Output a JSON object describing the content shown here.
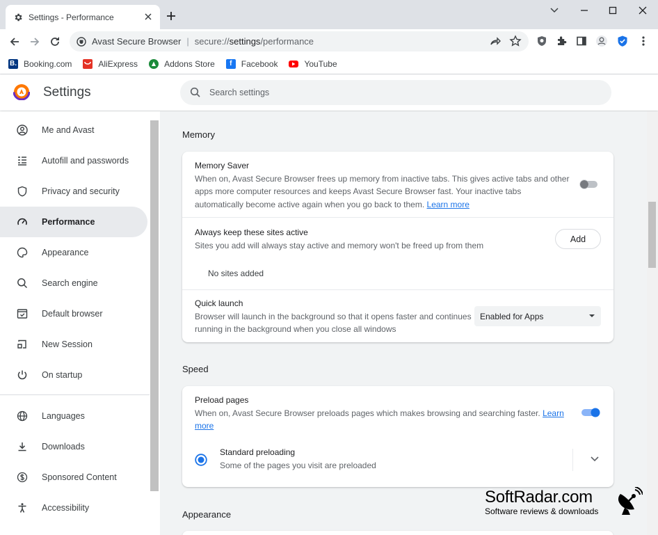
{
  "browser": {
    "tab_title": "Settings - Performance",
    "omnibox_site": "Avast Secure Browser",
    "omnibox_url_prefix": "secure://",
    "omnibox_url_main": "settings",
    "omnibox_url_suffix": "/performance",
    "bookmarks": [
      {
        "label": "Booking.com",
        "icon": "booking-icon",
        "color": "#003580"
      },
      {
        "label": "AliExpress",
        "icon": "aliexpress-icon",
        "color": "#e43225"
      },
      {
        "label": "Addons Store",
        "icon": "addons-store-icon",
        "color": "#1b8a3a"
      },
      {
        "label": "Facebook",
        "icon": "facebook-icon",
        "color": "#1877f2"
      },
      {
        "label": "YouTube",
        "icon": "youtube-icon",
        "color": "#ff0000"
      }
    ]
  },
  "settings": {
    "title": "Settings",
    "search_placeholder": "Search settings",
    "sidebar": [
      {
        "label": "Me and Avast",
        "icon": "person-icon"
      },
      {
        "label": "Autofill and passwords",
        "icon": "autofill-icon"
      },
      {
        "label": "Privacy and security",
        "icon": "shield-icon"
      },
      {
        "label": "Performance",
        "icon": "speedometer-icon",
        "active": true
      },
      {
        "label": "Appearance",
        "icon": "palette-icon"
      },
      {
        "label": "Search engine",
        "icon": "search-icon"
      },
      {
        "label": "Default browser",
        "icon": "browser-icon"
      },
      {
        "label": "New Session",
        "icon": "new-session-icon"
      },
      {
        "label": "On startup",
        "icon": "power-icon"
      },
      {
        "label": "Languages",
        "icon": "globe-icon"
      },
      {
        "label": "Downloads",
        "icon": "download-icon"
      },
      {
        "label": "Sponsored Content",
        "icon": "dollar-icon"
      },
      {
        "label": "Accessibility",
        "icon": "accessibility-icon"
      }
    ],
    "memory": {
      "heading": "Memory",
      "saver_title": "Memory Saver",
      "saver_desc_1": "When on, Avast Secure Browser frees up memory from inactive tabs. This gives active tabs and other",
      "saver_desc_2": "apps more computer resources and keeps Avast Secure Browser fast. Your inactive tabs",
      "saver_desc_3": "automatically become active again when you go back to them.",
      "learn_more": "Learn more",
      "saver_enabled": false,
      "keep_title": "Always keep these sites active",
      "keep_desc": "Sites you add will always stay active and memory won't be freed up from them",
      "add_label": "Add",
      "no_sites": "No sites added",
      "quick_title": "Quick launch",
      "quick_desc_1": "Browser will launch in the background so that it opens faster and continues",
      "quick_desc_2": "running in the background when you close all windows",
      "quick_value": "Enabled for Apps"
    },
    "speed": {
      "heading": "Speed",
      "preload_title": "Preload pages",
      "preload_desc": "When on, Avast Secure Browser preloads pages which makes browsing and searching faster.",
      "learn": "Learn",
      "more": "more",
      "preload_enabled": true,
      "std_title": "Standard preloading",
      "std_desc": "Some of the pages you visit are preloaded"
    },
    "appearance_heading": "Appearance"
  },
  "watermark": {
    "title": "SoftRadar.com",
    "subtitle": "Software reviews & downloads"
  },
  "colors": {
    "accent": "#1a73e8",
    "toggle_on": "#1a73e8"
  }
}
